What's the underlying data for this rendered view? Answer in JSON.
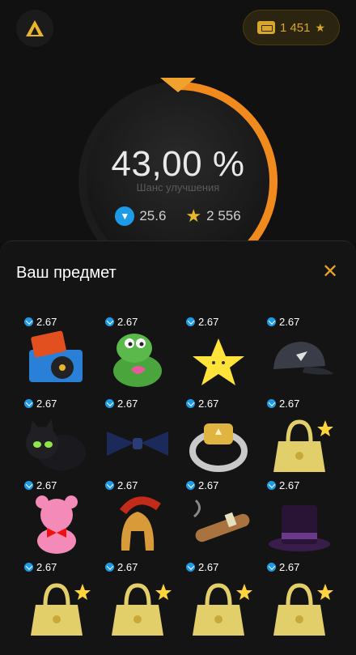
{
  "header": {
    "logo_icon": "triangle-logo-icon",
    "balance": {
      "value": "1 451",
      "star_icon": "star-icon",
      "ticket_icon": "ticket-icon"
    }
  },
  "upgrade": {
    "chance": "43,00 %",
    "label": "Шанс улучшения",
    "progress": 0.43,
    "ton_value": "25.6",
    "stars_value": "2 556",
    "accent": "#f08a1c"
  },
  "sheet": {
    "title": "Ваш предмет",
    "close_icon": "close-icon",
    "items": [
      {
        "name": "record-player",
        "price": "2.67"
      },
      {
        "name": "pepe-frog",
        "price": "2.67"
      },
      {
        "name": "lucky-star",
        "price": "2.67"
      },
      {
        "name": "durov-cap",
        "price": "2.67"
      },
      {
        "name": "black-cat",
        "price": "2.67"
      },
      {
        "name": "bow-tie",
        "price": "2.67"
      },
      {
        "name": "signet-ring",
        "price": "2.67"
      },
      {
        "name": "gold-bag",
        "price": "2.67"
      },
      {
        "name": "pink-teddy",
        "price": "2.67"
      },
      {
        "name": "spartan-helmet",
        "price": "2.67"
      },
      {
        "name": "cigar",
        "price": "2.67"
      },
      {
        "name": "top-hat",
        "price": "2.67"
      },
      {
        "name": "gold-bag",
        "price": "2.67"
      },
      {
        "name": "gold-bag",
        "price": "2.67"
      },
      {
        "name": "gold-bag",
        "price": "2.67"
      },
      {
        "name": "gold-bag",
        "price": "2.67"
      }
    ]
  }
}
